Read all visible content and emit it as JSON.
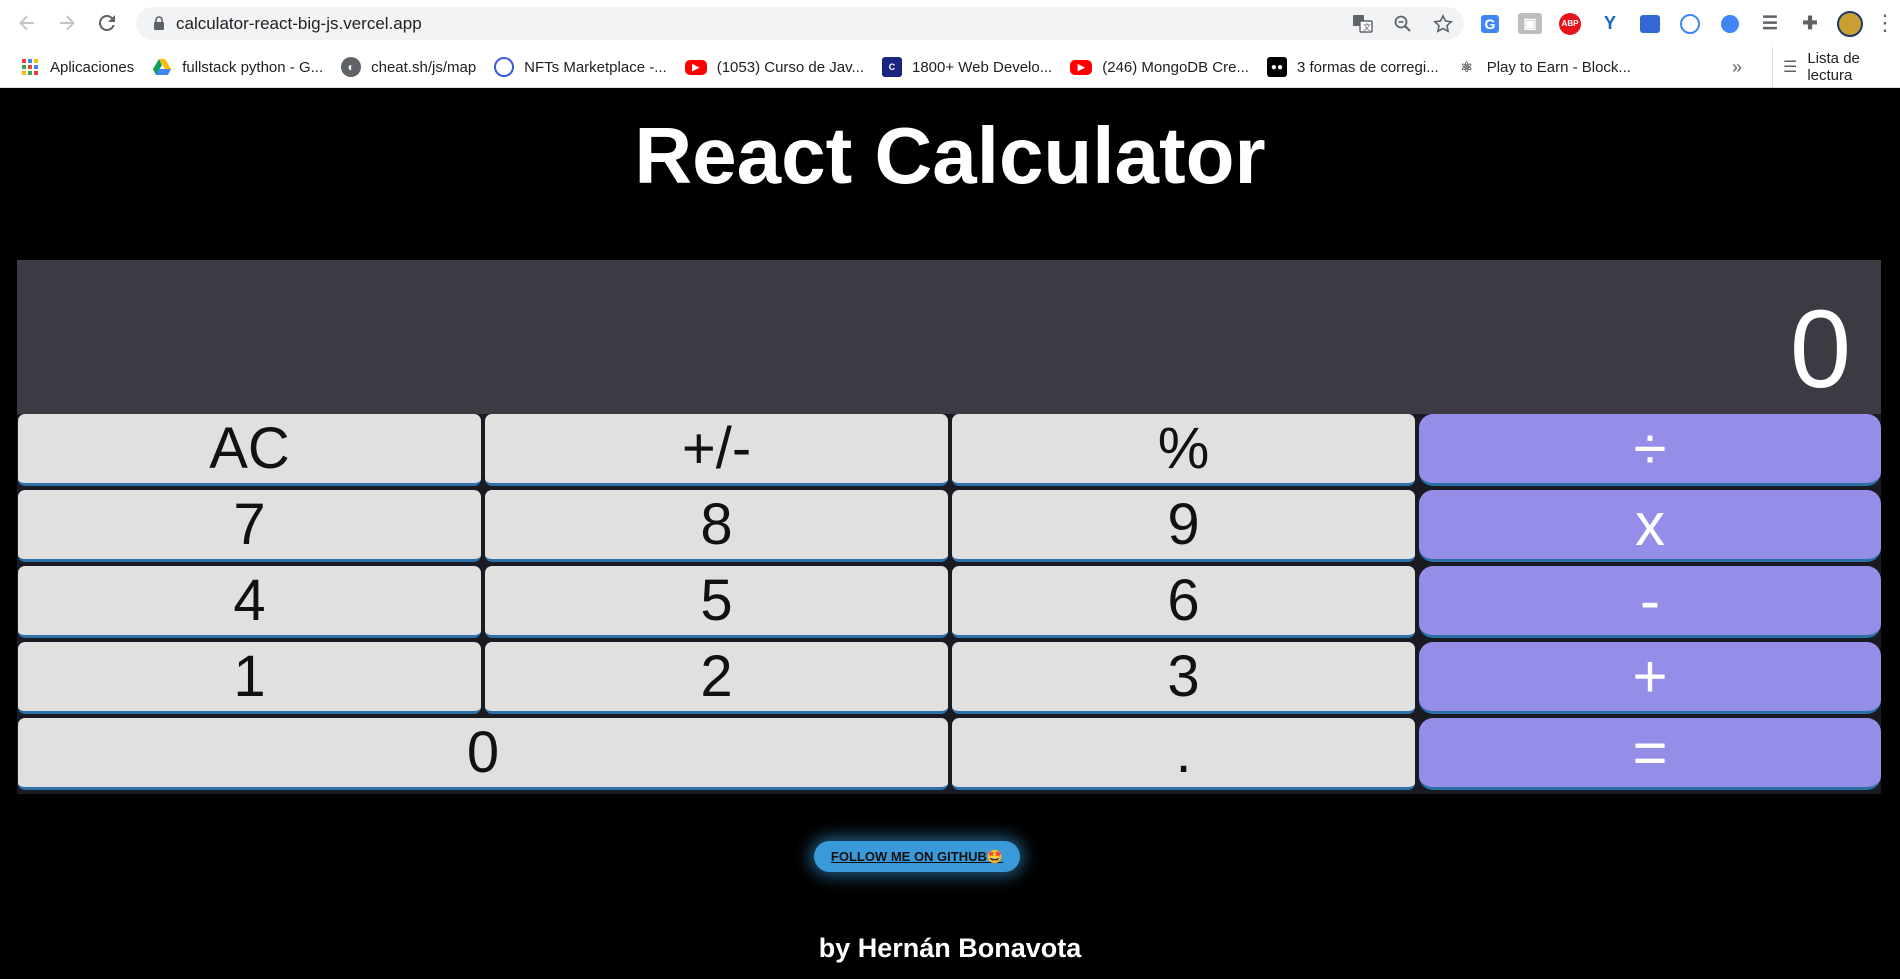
{
  "browser": {
    "url": "calculator-react-big-js.vercel.app",
    "bookmarks": [
      {
        "label": "Aplicaciones",
        "icon": "apps-grid-icon",
        "color": "#ea4335"
      },
      {
        "label": "fullstack python - G...",
        "icon": "google-drive-icon",
        "color": "#fbbc04"
      },
      {
        "label": "cheat.sh/js/map",
        "icon": "globe-icon",
        "color": "#5f6368"
      },
      {
        "label": "NFTs Marketplace -...",
        "icon": "fingerprint-icon",
        "color": "#3b5cd9"
      },
      {
        "label": "(1053) Curso de Jav...",
        "icon": "youtube-icon",
        "color": "#ff0000"
      },
      {
        "label": "1800+ Web Develo...",
        "icon": "coderhouse-icon",
        "color": "#1a237e"
      },
      {
        "label": "(246) MongoDB Cre...",
        "icon": "youtube-icon",
        "color": "#ff0000"
      },
      {
        "label": "3 formas de corregi...",
        "icon": "medium-icon",
        "color": "#000000"
      },
      {
        "label": "Play to Earn - Block...",
        "icon": "network-icon",
        "color": "#5f6368"
      }
    ],
    "more_label": "»",
    "reading_list_label": "Lista de lectura"
  },
  "page": {
    "title": "React Calculator",
    "display_value": "0",
    "github_label": "FOLLOW ME ON GITHUB🤩",
    "author": "by Hernán Bonavota"
  },
  "keypad": {
    "keys": [
      "AC",
      "+/-",
      "%",
      "÷",
      "7",
      "8",
      "9",
      "x",
      "4",
      "5",
      "6",
      "-",
      "1",
      "2",
      "3",
      "+",
      "0",
      ".",
      "="
    ]
  },
  "colors": {
    "background": "#000000",
    "display_bg": "#3c3b43",
    "key_bg": "#e0e0e0",
    "operator_bg": "#958ee8",
    "github_button": "#3a9ad9"
  }
}
